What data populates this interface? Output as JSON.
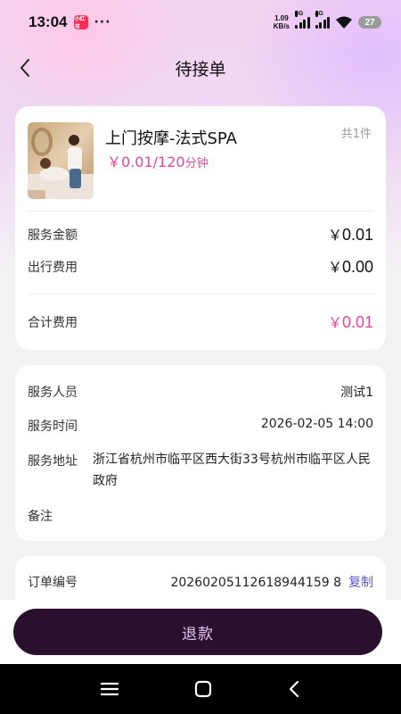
{
  "status_bar": {
    "time": "13:04",
    "app_badge": "小红书",
    "dots": "···",
    "net_speed_value": "1.09",
    "net_speed_unit": "KB/s",
    "sig1_tag": "4G",
    "sig2_tag": "4G",
    "battery": "27"
  },
  "header": {
    "title": "待接单"
  },
  "product": {
    "name": "上门按摩-法式SPA",
    "price_prefix": "￥",
    "price": "0.01/120",
    "price_unit": "分钟",
    "count": "共1件"
  },
  "fees": {
    "service_label": "服务金额",
    "service_yen": "￥",
    "service_value": "0.01",
    "travel_label": "出行费用",
    "travel_yen": "￥",
    "travel_value": "0.00",
    "total_label": "合计费用",
    "total_yen": "￥",
    "total_value": "0.01"
  },
  "service_info": {
    "staff_label": "服务人员",
    "staff_value": "测试1",
    "time_label": "服务时间",
    "time_value": "2026-02-05 14:00",
    "address_label": "服务地址",
    "address_value": "浙江省杭州市临平区西大街33号杭州市临平区人民政府",
    "note_label": "备注"
  },
  "order": {
    "number_label": "订单编号",
    "number_value": "20260205112618944159 8",
    "copy_label": "复制"
  },
  "footer": {
    "refund_label": "退款"
  },
  "colors": {
    "accent_pink": "#e0489e",
    "button_dark": "#2b0f2e",
    "link_purple": "#5a57c8"
  },
  "icons": {
    "back": "chevron-left-icon",
    "wifi": "wifi-icon",
    "signal": "signal-icon",
    "menu": "menu-icon",
    "home": "home-square-icon",
    "sys_back": "back-triangle-icon"
  }
}
